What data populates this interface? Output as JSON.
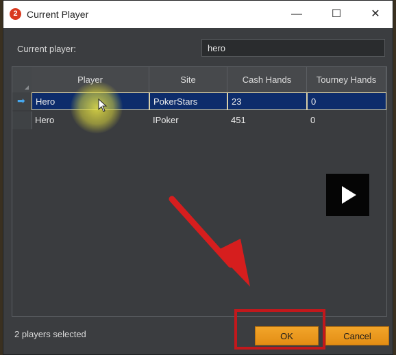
{
  "window": {
    "title": "Current Player",
    "app_icon_glyph": "2",
    "controls": {
      "minimize": "—",
      "maximize": "☐",
      "close": "✕"
    }
  },
  "current_player": {
    "label": "Current player:",
    "value": "hero"
  },
  "table": {
    "columns": [
      "Player",
      "Site",
      "Cash Hands",
      "Tourney Hands"
    ],
    "rows": [
      {
        "player": "Hero",
        "site": "PokerStars",
        "cash_hands": "23",
        "tourney_hands": "0",
        "selected": true
      },
      {
        "player": "Hero",
        "site": "IPoker",
        "cash_hands": "451",
        "tourney_hands": "0",
        "selected": false
      }
    ]
  },
  "status": {
    "text": "2 players selected"
  },
  "buttons": {
    "ok": "OK",
    "cancel": "Cancel"
  },
  "colors": {
    "accent_orange": "#f2a52a",
    "selection_blue": "#0d2c6b",
    "annotation_red": "#c2181c",
    "app_icon_red": "#d9391f"
  },
  "icons": {
    "app": "pokertracker-logo-icon",
    "row_pointer": "arrow-right-icon",
    "video": "play-icon"
  }
}
